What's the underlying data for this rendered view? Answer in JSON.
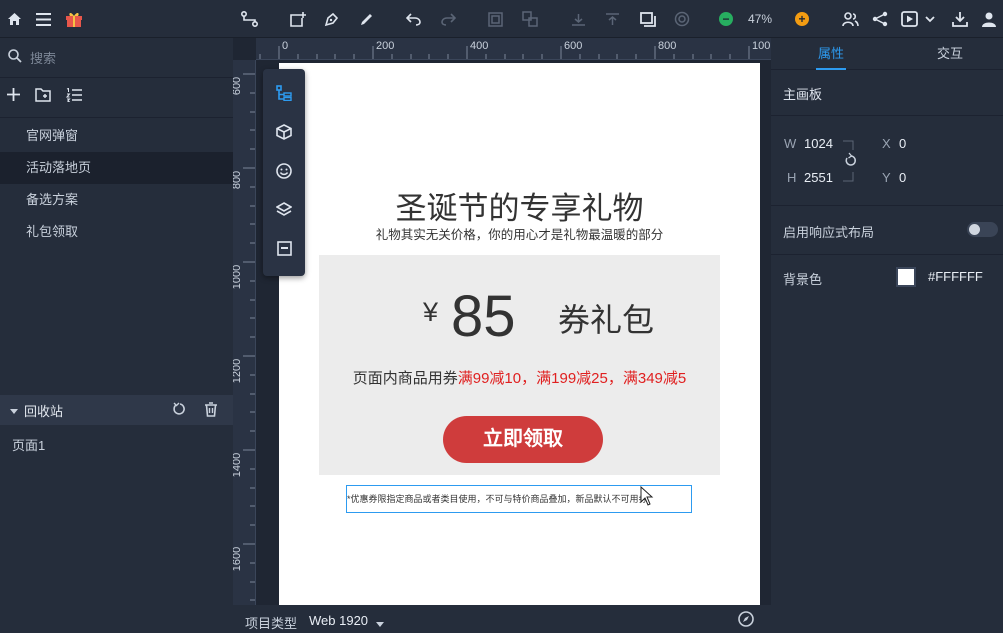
{
  "toolbar": {
    "zoom_level": "47%",
    "icons": [
      "home-icon",
      "menu-icon",
      "gift-icon",
      "connector-icon",
      "add-shape-icon",
      "pen-icon",
      "pencil-icon",
      "undo-icon",
      "redo-icon",
      "group-icon",
      "ungroup-icon",
      "align-bottom-icon",
      "align-top-icon",
      "frame-icon",
      "component-icon",
      "zoom-out-icon",
      "zoom-in-icon",
      "team-icon",
      "share-icon",
      "preview-icon",
      "download-icon",
      "avatar-icon"
    ],
    "colors": {
      "zoom_out": "#27ae60",
      "zoom_in": "#f39c12"
    }
  },
  "left_panel": {
    "search_placeholder": "搜索",
    "pages": [
      {
        "label": "官网弹窗",
        "active": false
      },
      {
        "label": "活动落地页",
        "active": true
      },
      {
        "label": "备选方案",
        "active": false
      },
      {
        "label": "礼包领取",
        "active": false
      }
    ],
    "recycle_bin": {
      "label": "回收站",
      "items": [
        "页面1"
      ]
    }
  },
  "rulers": {
    "horizontal": [
      "0",
      "200",
      "400",
      "600",
      "800",
      "100"
    ],
    "vertical": [
      "600",
      "800",
      "1000",
      "1200",
      "1400",
      "1600"
    ]
  },
  "artboard": {
    "title": "圣诞节的专享礼物",
    "subtitle": "礼物其实无关价格，你的用心才是礼物最温暖的部分",
    "coupon": {
      "currency": "¥",
      "amount": "85",
      "name": "券礼包",
      "rule_prefix": "页面内商品用券",
      "rules": [
        "满99减10",
        "，",
        "满199减25",
        "，",
        "满349减5"
      ],
      "button_label": "立即领取",
      "colors": {
        "rule": "#e02020",
        "button": "#cf3c3c",
        "card": "#ececec"
      }
    },
    "note": "*优惠券限指定商品或者类目使用，不可与特价商品叠加，新品默认不可用券"
  },
  "bottom_bar": {
    "project_type_label": "项目类型",
    "project_type_value": "Web 1920"
  },
  "right_panel": {
    "tabs": [
      {
        "label": "属性",
        "active": true
      },
      {
        "label": "交互",
        "active": false
      }
    ],
    "section_title": "主画板",
    "width_label": "W",
    "width_value": "1024",
    "height_label": "H",
    "height_value": "2551",
    "x_label": "X",
    "x_value": "0",
    "y_label": "Y",
    "y_value": "0",
    "responsive_label": "启用响应式布局",
    "responsive_enabled": false,
    "background_label": "背景色",
    "background_value": "#FFFFFF",
    "accent_color": "#2d9bf0"
  }
}
